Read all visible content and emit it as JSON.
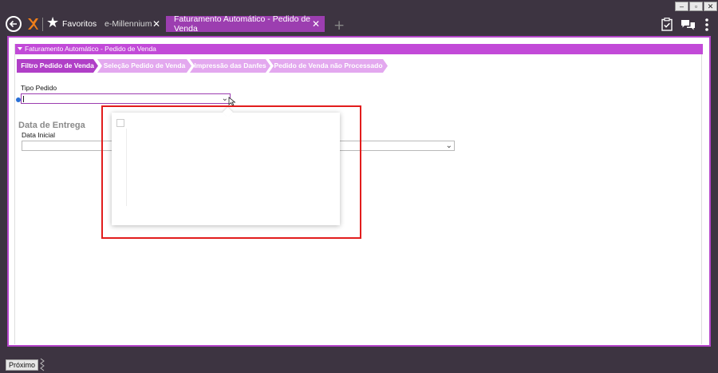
{
  "window": {
    "controls": [
      "–",
      "▫",
      "✕"
    ]
  },
  "nav": {
    "favorites_label": "Favoritos",
    "tabs": [
      {
        "label": "e-Millennium",
        "active": false
      },
      {
        "label": "Faturamento Automático - Pedido de Venda",
        "active": true
      }
    ],
    "icons": [
      "back-icon",
      "logo-icon",
      "star-icon",
      "close-icon",
      "plus-icon",
      "clipboard-check-icon",
      "chat-icon",
      "kebab-menu-icon"
    ]
  },
  "section": {
    "title": "Faturamento Automático - Pedido de Venda"
  },
  "steps": [
    {
      "label": "Filtro Pedido de Venda",
      "active": true
    },
    {
      "label": "Seleção Pedido de Venda",
      "active": false
    },
    {
      "label": "Impressão das Danfes",
      "active": false
    },
    {
      "label": "Pedido de Venda não Processado",
      "active": false
    }
  ],
  "form": {
    "tipo_pedido_label": "Tipo Pedido",
    "tipo_pedido_value": "",
    "group_title": "Data de Entrega",
    "data_inicial_label": "Data Inicial",
    "data_inicial_value": ""
  },
  "footer": {
    "next_label": "Próximo"
  },
  "colors": {
    "titlebar": "#3d3441",
    "accent": "#9c3eb0",
    "header": "#c24ad8",
    "step_inactive": "#e3a8ef",
    "highlight": "#e21d1d"
  }
}
